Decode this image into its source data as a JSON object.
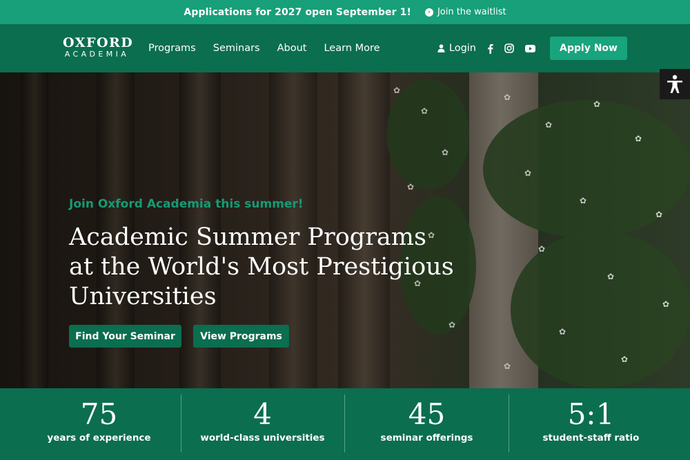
{
  "announcement": {
    "message": "Applications for 2027 open September 1!",
    "waitlist_label": "Join the waitlist",
    "waitlist_icon": "arrow-right-circle-icon"
  },
  "brand": {
    "name_top": "OXFORD",
    "name_bottom": "ACADEMIA"
  },
  "nav": {
    "items": [
      "Programs",
      "Seminars",
      "About",
      "Learn More"
    ],
    "login_label": "Login",
    "social_icons": [
      "facebook-icon",
      "instagram-icon",
      "youtube-icon"
    ],
    "apply_label": "Apply Now"
  },
  "accessibility": {
    "icon": "accessibility-icon"
  },
  "hero": {
    "subtitle": "Join Oxford Academia this summer!",
    "title": "Academic Summer Programs at the World's Most Prestigious Universities",
    "primary_button": "Find Your Seminar",
    "secondary_button": "View Programs"
  },
  "stats": [
    {
      "value": "75",
      "label": "years of experience"
    },
    {
      "value": "4",
      "label": "world-class universities"
    },
    {
      "value": "45",
      "label": "seminar offerings"
    },
    {
      "value": "5:1",
      "label": "student-staff ratio"
    }
  ],
  "colors": {
    "announce_bg": "#17a07a",
    "nav_bg": "#0b6e4f",
    "accent": "#18a47c",
    "stats_bg": "#0b6e4f"
  }
}
